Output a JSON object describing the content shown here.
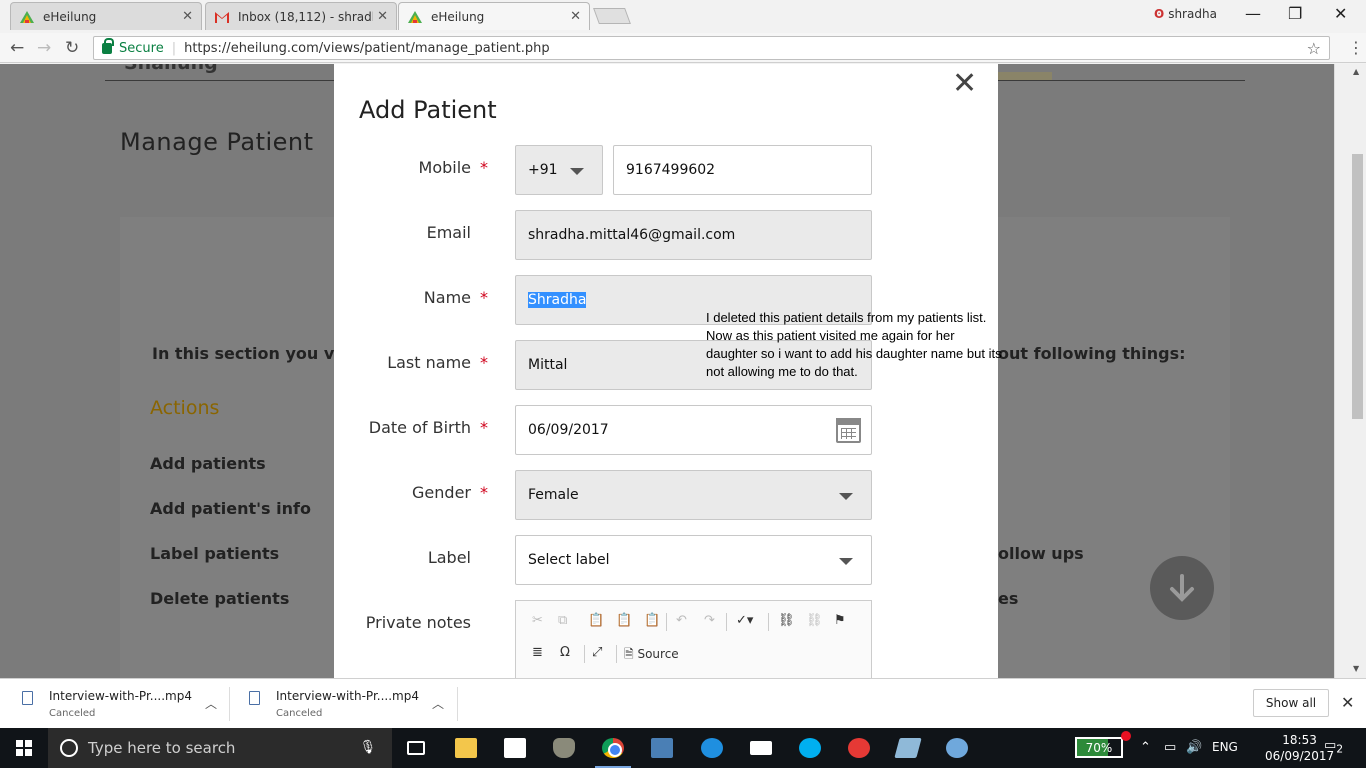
{
  "browser": {
    "tabs": [
      {
        "title": "eHeilung",
        "icon": "eheilung-favicon"
      },
      {
        "title": "Inbox (18,112) - shradha",
        "icon": "gmail-favicon"
      },
      {
        "title": "eHeilung",
        "icon": "eheilung-favicon"
      }
    ],
    "profile_name": "shradha",
    "secure_label": "Secure",
    "url": "https://eheilung.com/views/patient/manage_patient.php"
  },
  "page": {
    "header_snippet": "Shailung",
    "title": "Manage Patient",
    "intro_left": "In this section you v",
    "intro_right": "out following things:",
    "actions_heading": "Actions",
    "actions": [
      "Add patients",
      "Add patient's info",
      "Label patients",
      "Delete patients"
    ],
    "right_items": [
      "ollow ups",
      "es"
    ]
  },
  "modal": {
    "title": "Add Patient",
    "close_glyph": "✕",
    "fields": {
      "mobile": {
        "label": "Mobile",
        "country_code": "+91",
        "value": "9167499602"
      },
      "email": {
        "label": "Email",
        "value": "shradha.mittal46@gmail.com"
      },
      "name": {
        "label": "Name",
        "value": "Shradha"
      },
      "last_name": {
        "label": "Last name",
        "value": "Mittal"
      },
      "dob": {
        "label": "Date of Birth",
        "value": "06/09/2017"
      },
      "gender": {
        "label": "Gender",
        "value": "Female"
      },
      "label": {
        "label": "Label",
        "value": "Select label"
      },
      "private_notes": {
        "label": "Private notes",
        "source_label": "Source"
      }
    },
    "required_marker": "*"
  },
  "note": "I deleted this patient details from my patients list. Now as this patient visited me again for her daughter so i want to add his daughter name but its not allowing me to do that.",
  "downloads": {
    "items": [
      {
        "name": "Interview-with-Pr....mp4",
        "status": "Canceled"
      },
      {
        "name": "Interview-with-Pr....mp4",
        "status": "Canceled"
      }
    ],
    "show_all": "Show all"
  },
  "taskbar": {
    "search_placeholder": "Type here to search",
    "battery": "70%",
    "language": "ENG",
    "time": "18:53",
    "date": "06/09/2017",
    "notifications": "2"
  },
  "colors": {
    "required": "#d0021b",
    "secure": "#0b8043",
    "actions_heading": "#8a6500",
    "selection": "#3390ff"
  }
}
